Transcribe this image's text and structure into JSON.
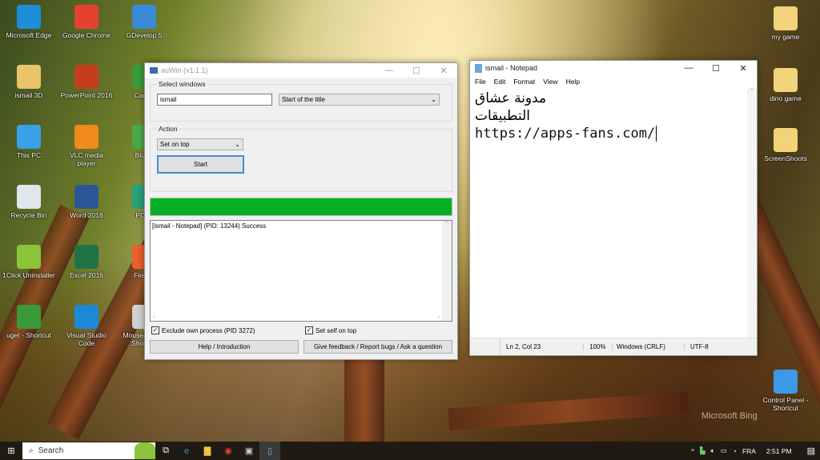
{
  "desktop": {
    "left_icons": [
      {
        "label": "Microsoft Edge",
        "icon": "edge-icon",
        "color": "#1d8ed8"
      },
      {
        "label": "Google Chrome",
        "icon": "chrome-icon",
        "color": "#e5412f"
      },
      {
        "label": "GDevelop 5",
        "icon": "gdevelop-icon",
        "color": "#3b8ad8"
      },
      {
        "label": "ismail 3D",
        "icon": "user-folder-icon",
        "color": "#e8c46a"
      },
      {
        "label": "PowerPoint 2016",
        "icon": "powerpoint-icon",
        "color": "#c43e1c"
      },
      {
        "label": "Camta",
        "icon": "camtasia-icon",
        "color": "#3a9a3a"
      },
      {
        "label": "This PC",
        "icon": "computer-icon",
        "color": "#3aa0e8"
      },
      {
        "label": "VLC media player",
        "icon": "vlc-icon",
        "color": "#f08a1c"
      },
      {
        "label": "BlueS",
        "icon": "bluestacks-icon",
        "color": "#4aa84a"
      },
      {
        "label": "Recycle Bin",
        "icon": "recycle-bin-icon",
        "color": "#dfe6ee"
      },
      {
        "label": "Word 2016",
        "icon": "word-icon",
        "color": "#2b579a"
      },
      {
        "label": "PC M",
        "icon": "pc-manager-icon",
        "color": "#2aa07a"
      },
      {
        "label": "1Click Uninstaller",
        "icon": "uninstaller-icon",
        "color": "#8ac43a"
      },
      {
        "label": "Excel 2016",
        "icon": "excel-icon",
        "color": "#217346"
      },
      {
        "label": "Firefox",
        "icon": "firefox-icon",
        "color": "#e8602a"
      },
      {
        "label": "uget - Shortcut",
        "icon": "uget-icon",
        "color": "#3a9a3a"
      },
      {
        "label": "Visual Studio Code",
        "icon": "vscode-icon",
        "color": "#1e88d8"
      },
      {
        "label": "MouseJiggle - Shortcut",
        "icon": "mouse-icon",
        "color": "#d0d0d0"
      }
    ],
    "right_icons": [
      {
        "label": "my game",
        "icon": "folder-icon",
        "color": "#f2d37a"
      },
      {
        "label": "dino game",
        "icon": "folder-icon",
        "color": "#f2d37a"
      },
      {
        "label": "ScreenShoots",
        "icon": "folder-icon",
        "color": "#f2d37a"
      },
      {
        "label": "Control Panel - Shortcut",
        "icon": "control-panel-icon",
        "color": "#3a9ae8"
      }
    ],
    "watermark": "Microsoft Bing"
  },
  "auwin": {
    "title": "auWin (v1.1.1)",
    "select_group": "Select windows",
    "search_value": "ismail",
    "match_mode": "Start of the title",
    "action_group": "Action",
    "action_value": "Set on top",
    "start_label": "Start",
    "progress_percent": 100,
    "progress_color": "#06b025",
    "log": [
      "[ismail - Notepad] (PID: 13244) Success"
    ],
    "exclude_label": "Exclude own process (PID 3272)",
    "exclude_checked": true,
    "self_top_label": "Set self on top",
    "self_top_checked": true,
    "help_label": "Help / Introduction",
    "feedback_label": "Give feedback / Report bugs / Ask a question"
  },
  "notepad": {
    "title": "ismail - Notepad",
    "menu": [
      "File",
      "Edit",
      "Format",
      "View",
      "Help"
    ],
    "lines": [
      "مدونة عشاق التطبيقات",
      "https://apps-fans.com/"
    ],
    "status": {
      "position": "Ln 2, Col 23",
      "zoom": "100%",
      "eol": "Windows (CRLF)",
      "encoding": "UTF-8"
    }
  },
  "taskbar": {
    "search_placeholder": "Search",
    "lang": "FRA",
    "time": "2:51 PM"
  }
}
